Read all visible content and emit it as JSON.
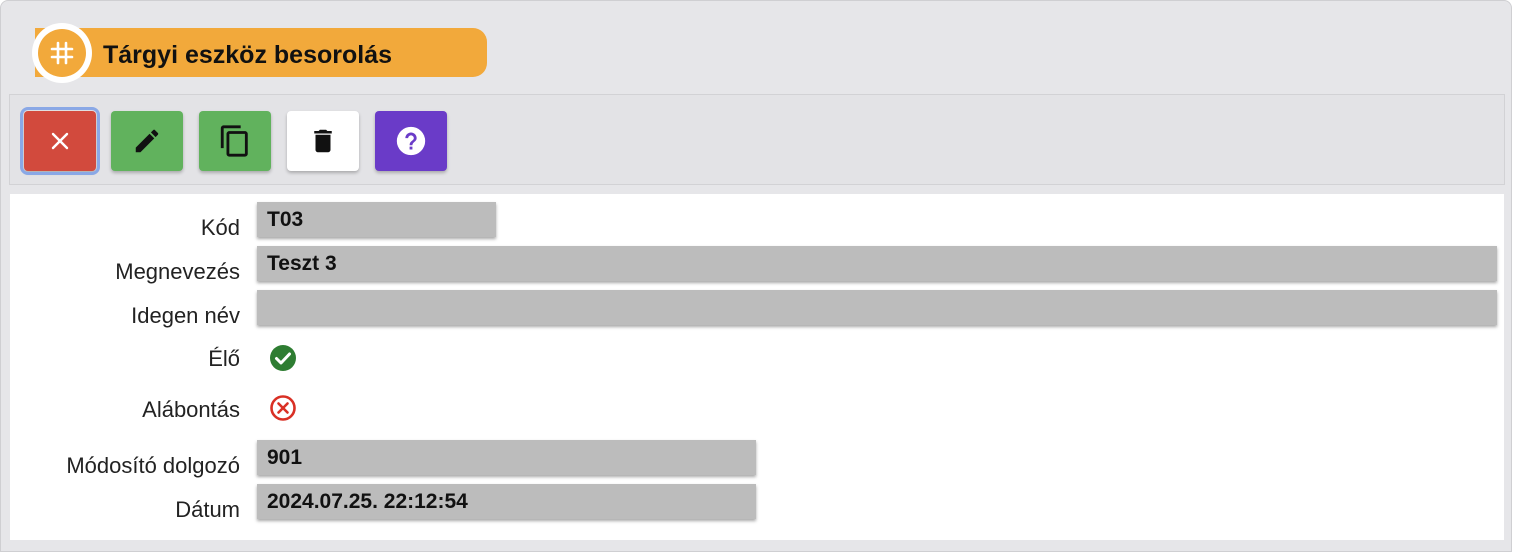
{
  "header": {
    "title": "Tárgyi eszköz besorolás",
    "icon": "hash-icon"
  },
  "toolbar": {
    "buttons": [
      {
        "name": "close-button",
        "icon": "close-icon",
        "color": "#d24a3d"
      },
      {
        "name": "edit-button",
        "icon": "pencil-icon",
        "color": "#61b25d"
      },
      {
        "name": "copy-button",
        "icon": "copy-icon",
        "color": "#61b25d"
      },
      {
        "name": "delete-button",
        "icon": "trash-icon",
        "color": "#ffffff"
      },
      {
        "name": "help-button",
        "icon": "help-icon",
        "color": "#6a3bc8"
      }
    ]
  },
  "form": {
    "kod": {
      "label": "Kód",
      "value": "T03"
    },
    "megnevezes": {
      "label": "Megnevezés",
      "value": "Teszt 3"
    },
    "idegen_nev": {
      "label": "Idegen név",
      "value": ""
    },
    "elo": {
      "label": "Élő",
      "checked": true,
      "icon": "check-circle-icon",
      "color": "#2e7d32"
    },
    "alabontas": {
      "label": "Alábontás",
      "checked": false,
      "icon": "x-circle-icon",
      "color": "#d93025"
    },
    "modosito_dolgozo": {
      "label": "Módosító dolgozó",
      "value": "901"
    },
    "datum": {
      "label": "Dátum",
      "value": "2024.07.25. 22:12:54"
    }
  }
}
